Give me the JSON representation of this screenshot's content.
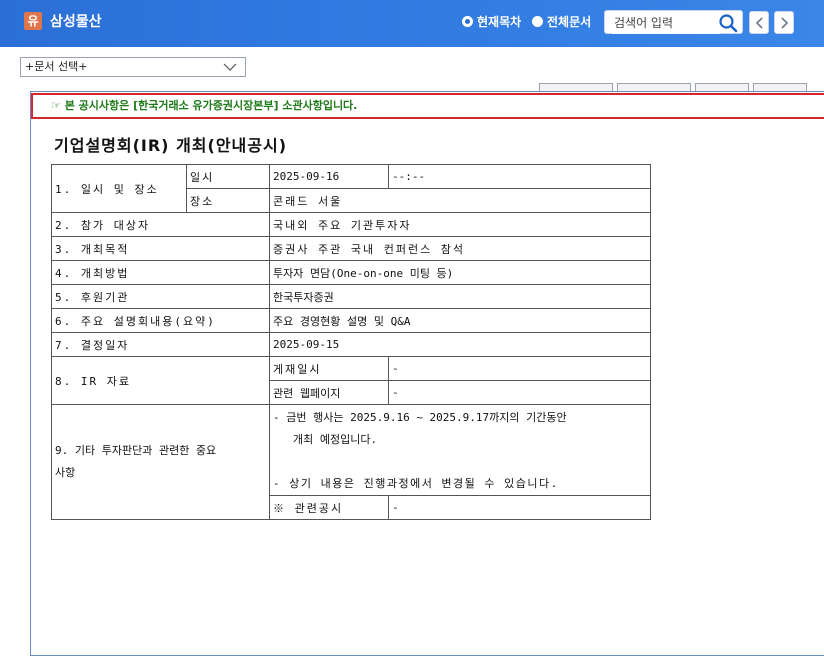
{
  "header": {
    "logo_char": "유",
    "company": "삼성물산",
    "radio_current": "현재목차",
    "radio_all": "전체문서",
    "search_placeholder": "검색어 입력"
  },
  "doc_select": {
    "label": "+문서 선택+"
  },
  "notice": "☞ 본 공시사항은 [한국거래소 유가증권시장본부] 소관사항입니다.",
  "document": {
    "title": "기업설명회(IR) 개최(안내공시)",
    "rows": {
      "r1_label": "1. 일시 및 장소",
      "r1_sub1": "일시",
      "r1_date": "2025-09-16",
      "r1_time": "--:--",
      "r1_sub2": "장소",
      "r1_place": "콘래드 서울",
      "r2_label": "2. 참가 대상자",
      "r2_value": "국내외 주요 기관투자자",
      "r3_label": "3. 개최목적",
      "r3_value": "증권사 주관 국내 컨퍼런스 참석",
      "r4_label": "4. 개최방법",
      "r4_value": "투자자 면담(One-on-one 미팅 등)",
      "r5_label": "5. 후원기관",
      "r5_value": "한국투자증권",
      "r6_label": "6. 주요 설명회내용(요약)",
      "r6_value": "주요 경영현황 설명 및 Q&A",
      "r7_label": "7. 결정일자",
      "r7_value": "2025-09-15",
      "r8_label": "8. IR 자료",
      "r8_sub1": "게재일시",
      "r8_val1": "-",
      "r8_sub2": "관련 웹페이지",
      "r8_val2": "-",
      "r9_label_line1": "9. 기타 투자판단과 관련한 중요",
      "r9_label_line2": "사항",
      "r9_line1": "- 금번 행사는 2025.9.16 ~ 2025.9.17까지의 기간동안",
      "r9_line2": "개최 예정입니다.",
      "r9_line3": "- 상기 내용은 진행과정에서 변경될 수 있습니다.",
      "related_label": "※ 관련공시",
      "related_value": "-"
    }
  }
}
